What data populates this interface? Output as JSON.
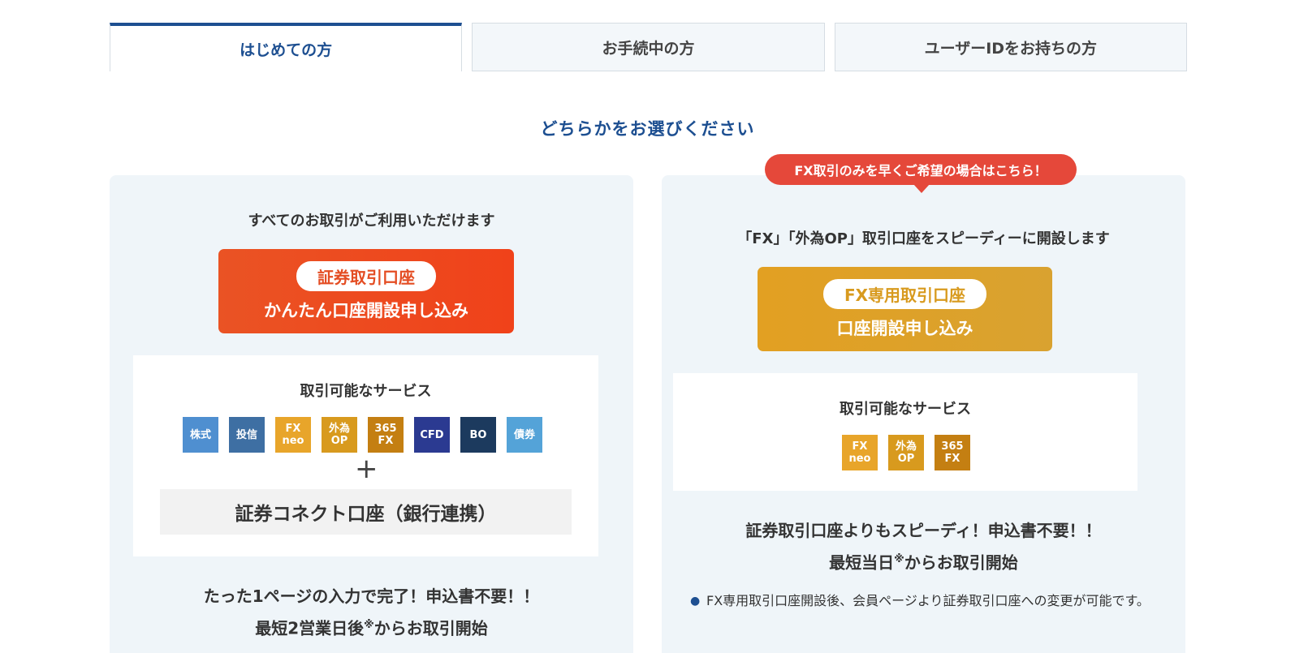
{
  "tabs": [
    {
      "label": "はじめての方"
    },
    {
      "label": "お手続中の方"
    },
    {
      "label": "ユーザーIDをお持ちの方"
    }
  ],
  "heading": "どちらかをお選びください",
  "left_panel": {
    "lead": "すべてのお取引がご利用いただけます",
    "cta_pill": "証券取引口座",
    "cta_sub": "かんたん口座開設申し込み",
    "services_title": "取引可能なサービス",
    "icons": [
      {
        "text": "株式",
        "color": "#4f8fd0",
        "name": "stock-icon"
      },
      {
        "text": "投信",
        "color": "#3e6fa3",
        "name": "fund-icon"
      },
      {
        "text": "FX\nneo",
        "color": "#e8a52a",
        "name": "fx-neo-icon"
      },
      {
        "text": "外為\nOP",
        "color": "#d89a1e",
        "name": "fx-option-icon"
      },
      {
        "text": "365\nFX",
        "color": "#c47f12",
        "name": "365fx-icon"
      },
      {
        "text": "CFD",
        "color": "#2b3a91",
        "name": "cfd-icon"
      },
      {
        "text": "BO",
        "color": "#1c3a5e",
        "name": "bo-icon"
      },
      {
        "text": "債券",
        "color": "#54a3d8",
        "name": "bond-icon"
      }
    ],
    "plus": "+",
    "connect": "証券コネクト口座（銀行連携）",
    "bottom_line1": "たった1ページの入力で完了！申込書不要！！",
    "bottom_line2_pre": "最短2営業日後",
    "bottom_line2_sup": "※",
    "bottom_line2_post": "からお取引開始"
  },
  "right_panel": {
    "balloon": "FX取引のみを早くご希望の場合はこちら！",
    "lead": "「FX」「外為OP」取引口座をスピーディーに開設します",
    "cta_pill": "FX専用取引口座",
    "cta_sub": "口座開設申し込み",
    "services_title": "取引可能なサービス",
    "icons": [
      {
        "text": "FX\nneo",
        "color": "#e8a52a",
        "name": "fx-neo-icon"
      },
      {
        "text": "外為\nOP",
        "color": "#d89a1e",
        "name": "fx-option-icon"
      },
      {
        "text": "365\nFX",
        "color": "#c47f12",
        "name": "365fx-icon"
      }
    ],
    "bottom_line1": "証券取引口座よりもスピーディ！申込書不要！！",
    "bottom_line2_pre": "最短当日",
    "bottom_line2_sup": "※",
    "bottom_line2_post": "からお取引開始",
    "note_bullet": "●",
    "note": "FX専用取引口座開設後、会員ページより証券取引口座への変更が可能です。"
  }
}
